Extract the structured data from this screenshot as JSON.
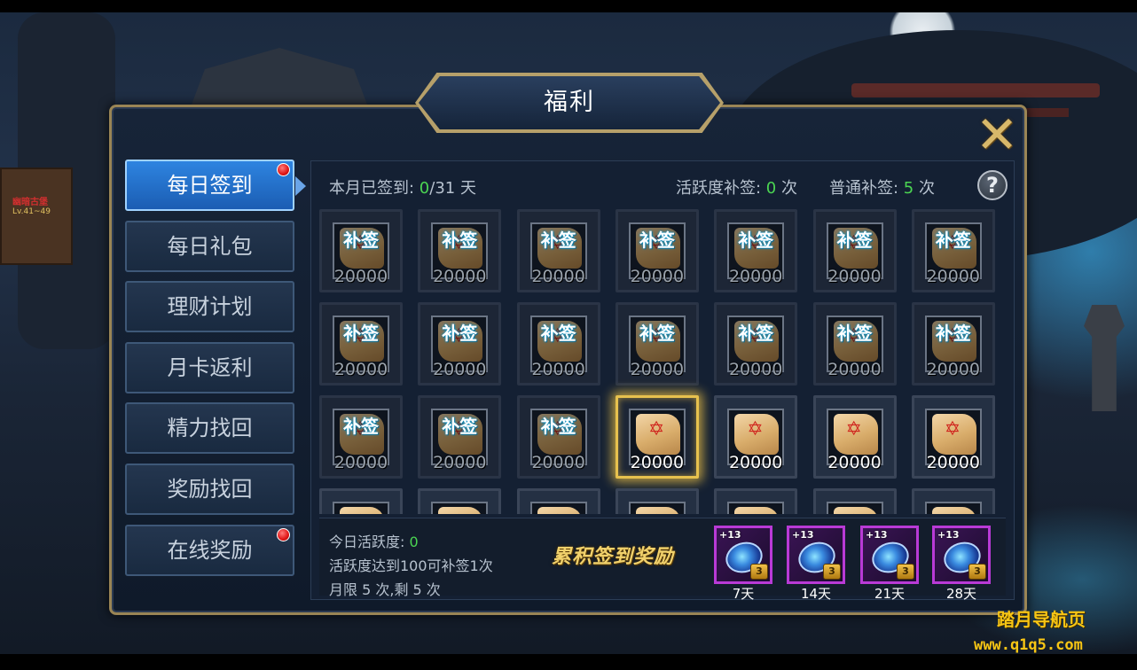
{
  "panel": {
    "title": "福利"
  },
  "sidebar": {
    "items": [
      {
        "label": "每日签到",
        "active": true,
        "badge": true
      },
      {
        "label": "每日礼包",
        "active": false,
        "badge": false
      },
      {
        "label": "理财计划",
        "active": false,
        "badge": false
      },
      {
        "label": "月卡返利",
        "active": false,
        "badge": false
      },
      {
        "label": "精力找回",
        "active": false,
        "badge": false
      },
      {
        "label": "奖励找回",
        "active": false,
        "badge": false
      },
      {
        "label": "在线奖励",
        "active": false,
        "badge": true
      }
    ]
  },
  "signin": {
    "month_label": "本月已签到: ",
    "signed": "0",
    "total": "/31 天",
    "active_resign_label": "活跃度补签: ",
    "active_resign_count": "0",
    "active_resign_unit": " 次",
    "normal_resign_label": "普通补签: ",
    "normal_resign_count": "5",
    "normal_resign_unit": " 次",
    "help_label": "?"
  },
  "grid": {
    "resign_label": "补签",
    "cells": [
      {
        "amount": "20000",
        "state": "past"
      },
      {
        "amount": "20000",
        "state": "past"
      },
      {
        "amount": "20000",
        "state": "past"
      },
      {
        "amount": "20000",
        "state": "past"
      },
      {
        "amount": "20000",
        "state": "past"
      },
      {
        "amount": "20000",
        "state": "past"
      },
      {
        "amount": "20000",
        "state": "past"
      },
      {
        "amount": "20000",
        "state": "past"
      },
      {
        "amount": "20000",
        "state": "past"
      },
      {
        "amount": "20000",
        "state": "past"
      },
      {
        "amount": "20000",
        "state": "past"
      },
      {
        "amount": "20000",
        "state": "past"
      },
      {
        "amount": "20000",
        "state": "past"
      },
      {
        "amount": "20000",
        "state": "past"
      },
      {
        "amount": "20000",
        "state": "past"
      },
      {
        "amount": "20000",
        "state": "past"
      },
      {
        "amount": "20000",
        "state": "past"
      },
      {
        "amount": "20000",
        "state": "today"
      },
      {
        "amount": "20000",
        "state": "future"
      },
      {
        "amount": "20000",
        "state": "future"
      },
      {
        "amount": "20000",
        "state": "future"
      },
      {
        "amount": "",
        "state": "future"
      },
      {
        "amount": "",
        "state": "future"
      },
      {
        "amount": "",
        "state": "future"
      },
      {
        "amount": "",
        "state": "future"
      },
      {
        "amount": "",
        "state": "future"
      },
      {
        "amount": "",
        "state": "future"
      },
      {
        "amount": "",
        "state": "future"
      }
    ]
  },
  "activity": {
    "today_label": "今日活跃度: ",
    "today_value": "0",
    "rule": "活跃度达到100可补签1次",
    "limit": "月限 5 次,剩 5 次"
  },
  "rewards": {
    "title": "累积签到奖励",
    "items": [
      {
        "plus": "+13",
        "day": "7天",
        "lock": "3"
      },
      {
        "plus": "+13",
        "day": "14天",
        "lock": "3"
      },
      {
        "plus": "+13",
        "day": "21天",
        "lock": "3"
      },
      {
        "plus": "+13",
        "day": "28天",
        "lock": "3"
      }
    ]
  },
  "background": {
    "sign_line1": "幽暗古堡",
    "sign_line2": "Lv.41~49"
  },
  "watermark": {
    "line1": "踏月导航页",
    "line2": "www.q1q5.com"
  },
  "colors": {
    "accent": "#2e84e0",
    "frame_gold": "#9a8555",
    "highlight_green": "#4bd552",
    "reward_purple": "#b93ad6"
  },
  "icons": {
    "close": "close-icon",
    "help": "help-icon",
    "badge": "red-dot-icon",
    "scroll": "scroll-icon",
    "reward": "orb-icon",
    "lock": "lock-icon"
  }
}
